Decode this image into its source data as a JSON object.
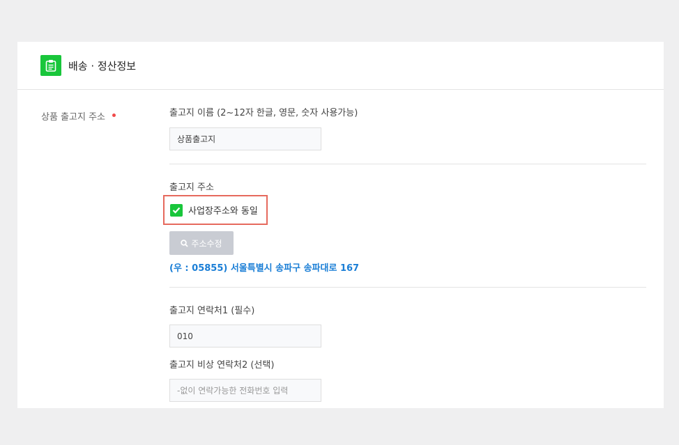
{
  "header": {
    "title": "배송 · 정산정보"
  },
  "row": {
    "label": "상품 출고지 주소"
  },
  "name_section": {
    "label": "출고지 이름 (2~12자 한글, 영문, 숫자 사용가능)",
    "value": "상품출고지"
  },
  "address_section": {
    "label": "출고지 주소",
    "same_as_business_label": "사업장주소와 동일",
    "same_as_business_checked": true,
    "edit_button_label": "주소수정",
    "address_text": "(우 : 05855) 서울특별시 송파구 송파대로 167"
  },
  "contact_section": {
    "label1": "출고지 연락처1 (필수)",
    "value1": "010",
    "label2": "출고지 비상 연락처2 (선택)",
    "placeholder2": "-없이 연락가능한 전화번호 입력"
  },
  "colors": {
    "accent_green": "#19c63b",
    "link_blue": "#1a7ed6",
    "required_red": "#f04a4a",
    "highlight": "#e6695d"
  }
}
